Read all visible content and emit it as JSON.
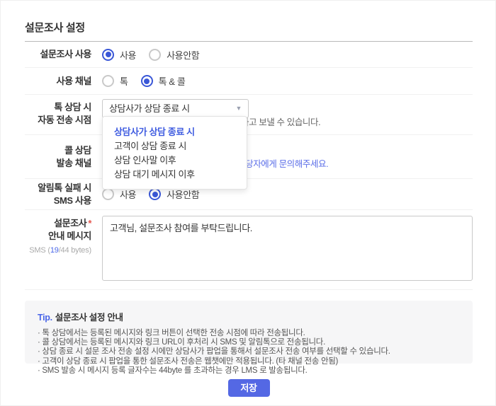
{
  "title": "설문조사 설정",
  "rows": {
    "survey_use": {
      "label": "설문조사 사용",
      "options": [
        {
          "label": "사용",
          "selected": true
        },
        {
          "label": "사용안함",
          "selected": false
        }
      ]
    },
    "channel": {
      "label": "사용 채널",
      "options": [
        {
          "label": "톡",
          "selected": false
        },
        {
          "label": "톡 & 콜",
          "selected": true
        }
      ]
    },
    "talk_send_time": {
      "label_line1": "톡 상담 시",
      "label_line2": "자동 전송 시점",
      "select_value": "상담사가 상담 종료 시",
      "hint_fragment": "하고 보낼 수 있습니다."
    },
    "call_channel": {
      "label_line1": "콜 상담",
      "label_line2": "발송 채널",
      "link_fragment": "담당자에게 문의해주세요."
    },
    "sms_fallback": {
      "label_line1": "알림톡 실패 시",
      "label_line2": "SMS 사용",
      "options": [
        {
          "label": "사용",
          "selected": false
        },
        {
          "label": "사용안함",
          "selected": true
        }
      ]
    },
    "message": {
      "label_line1": "설문조사",
      "label_line2": "안내 메시지",
      "required_mark": "*",
      "byte_prefix": "SMS (",
      "byte_current": "19",
      "byte_suffix": "/44 bytes)",
      "value": "고객님, 설문조사 참여를 부탁드립니다."
    }
  },
  "dropdown": {
    "caret": "▼",
    "options": [
      {
        "label": "상담사가 상담 종료 시",
        "selected": true
      },
      {
        "label": "고객이 상담 종료 시",
        "selected": false
      },
      {
        "label": "상담 인사말 이후",
        "selected": false
      },
      {
        "label": "상담 대기 메시지 이후",
        "selected": false
      }
    ]
  },
  "tip": {
    "label": "Tip.",
    "title": "설문조사 설정 안내",
    "items": [
      "· 톡 상담에서는 등록된 메시지와 링크 버튼이 선택한 전송 시점에 따라 전송됩니다.",
      "· 콜 상담에서는 등록된 메시지와 링크 URL이 후처리 시 SMS 및 알림톡으로 전송됩니다.",
      "· 상담 종료 시 설문 조사 전송 설정 시에만 상담사가 팝업을 통해서 설문조사 전송 여부를 선택할 수 있습니다.",
      "· 고객이 상담 종료 시 팝업을 통한 설문조사 전송은 웹챗에만 적용됩니다. (타 채널 전송 안됨)",
      "· SMS 발송 시 메시지 등록 글자수는 44byte 를 초과하는 경우 LMS 로 발송됩니다."
    ]
  },
  "save_label": "저장",
  "colors": {
    "radio_blue": "#3a57d7",
    "accent_blue": "#4a66e8",
    "link_blue": "#5b6ee8",
    "button_blue": "#5468e4",
    "required_red": "#e5544b"
  }
}
